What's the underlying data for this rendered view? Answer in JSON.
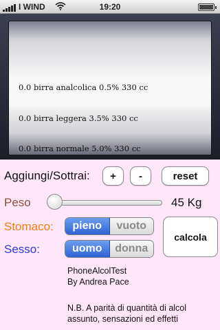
{
  "status_bar": {
    "carrier": "I WIND",
    "time": "19:20"
  },
  "picker": {
    "rows": [
      "0.0 birra analcolica 0.5% 330 cc",
      "0.0 birra leggera 3.5% 330 cc",
      "0.0 birra normale 5.0% 330 cc"
    ]
  },
  "controls": {
    "add_remove_label": "Aggiungi/Sottrai:",
    "plus_label": "+",
    "minus_label": "-",
    "reset_label": "reset",
    "weight_label": "Peso",
    "weight_value": "45 Kg",
    "weight_slider_fraction": 0.0,
    "stomach_label": "Stomaco:",
    "stomach_options": [
      "pieno",
      "vuoto"
    ],
    "stomach_selected": "pieno",
    "sex_label": "Sesso:",
    "sex_options": [
      "uomo",
      "donna"
    ],
    "sex_selected": "uomo",
    "calc_label": "calcola"
  },
  "info": {
    "app_name": "PhoneAlcolTest",
    "author": "By Andrea Pace",
    "note": "N.B. A parità di quantità di alcol assunto, sensazioni ed effetti"
  },
  "colors": {
    "background": "#ffe6f8",
    "peso_label": "#8b5040",
    "stomaco_label": "#f07f12",
    "sesso_label": "#2b3ed8",
    "segment_selected": "#2e63d5"
  }
}
